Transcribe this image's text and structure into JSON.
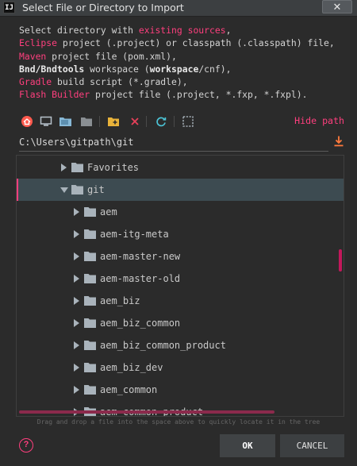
{
  "window": {
    "app_icon": "IJ",
    "title": "Select File or Directory to Import",
    "close_symbol": "✕"
  },
  "description": [
    [
      {
        "t": "Select directory with ",
        "s": ""
      },
      {
        "t": "existing sources",
        "s": "pink"
      },
      {
        "t": ",",
        "s": ""
      }
    ],
    [
      {
        "t": "Eclipse",
        "s": "pink"
      },
      {
        "t": " project (.project) or classpath (.classpath) file,",
        "s": ""
      }
    ],
    [
      {
        "t": "Maven",
        "s": "pink"
      },
      {
        "t": " project file (pom.xml),",
        "s": ""
      }
    ],
    [
      {
        "t": "Bnd/Bndtools",
        "s": "bold"
      },
      {
        "t": " workspace (",
        "s": ""
      },
      {
        "t": "workspace",
        "s": "bold"
      },
      {
        "t": "/cnf),",
        "s": ""
      }
    ],
    [
      {
        "t": "Gradle",
        "s": "pink"
      },
      {
        "t": " build script (*.gradle),",
        "s": ""
      }
    ],
    [
      {
        "t": "Flash Builder",
        "s": "pink"
      },
      {
        "t": " project file (.project, *.fxp, *.fxpl).",
        "s": ""
      }
    ]
  ],
  "toolbar": {
    "icons": [
      "home-icon",
      "desktop-icon",
      "project-folder-icon",
      "module-folder-icon",
      "new-folder-icon",
      "delete-icon",
      "refresh-icon",
      "toggle-hidden-icon"
    ],
    "hide_path_label": "Hide path"
  },
  "path": {
    "value": "C:\\Users\\gitpath\\git"
  },
  "tree": {
    "items": [
      {
        "label": "Favorites",
        "depth": 1,
        "expanded": false,
        "selected": false
      },
      {
        "label": "git",
        "depth": 1,
        "expanded": true,
        "selected": true
      },
      {
        "label": "aem",
        "depth": 2,
        "expanded": false,
        "selected": false
      },
      {
        "label": "aem-itg-meta",
        "depth": 2,
        "expanded": false,
        "selected": false
      },
      {
        "label": "aem-master-new",
        "depth": 2,
        "expanded": false,
        "selected": false
      },
      {
        "label": "aem-master-old",
        "depth": 2,
        "expanded": false,
        "selected": false
      },
      {
        "label": "aem_biz",
        "depth": 2,
        "expanded": false,
        "selected": false
      },
      {
        "label": "aem_biz_common",
        "depth": 2,
        "expanded": false,
        "selected": false
      },
      {
        "label": "aem_biz_common_product",
        "depth": 2,
        "expanded": false,
        "selected": false
      },
      {
        "label": "aem_biz_dev",
        "depth": 2,
        "expanded": false,
        "selected": false
      },
      {
        "label": "aem_common",
        "depth": 2,
        "expanded": false,
        "selected": false
      },
      {
        "label": "aem_common_product",
        "depth": 2,
        "expanded": false,
        "selected": false
      }
    ]
  },
  "hint": "Drag and drop a file into the space above to quickly locate it in the tree",
  "buttons": {
    "help_symbol": "?",
    "ok": "OK",
    "cancel": "CANCEL"
  },
  "colors": {
    "accent": "#ff3f7e",
    "background": "#2b2b2b",
    "selection": "#3d4b51",
    "folder": "#a9b3bb"
  }
}
